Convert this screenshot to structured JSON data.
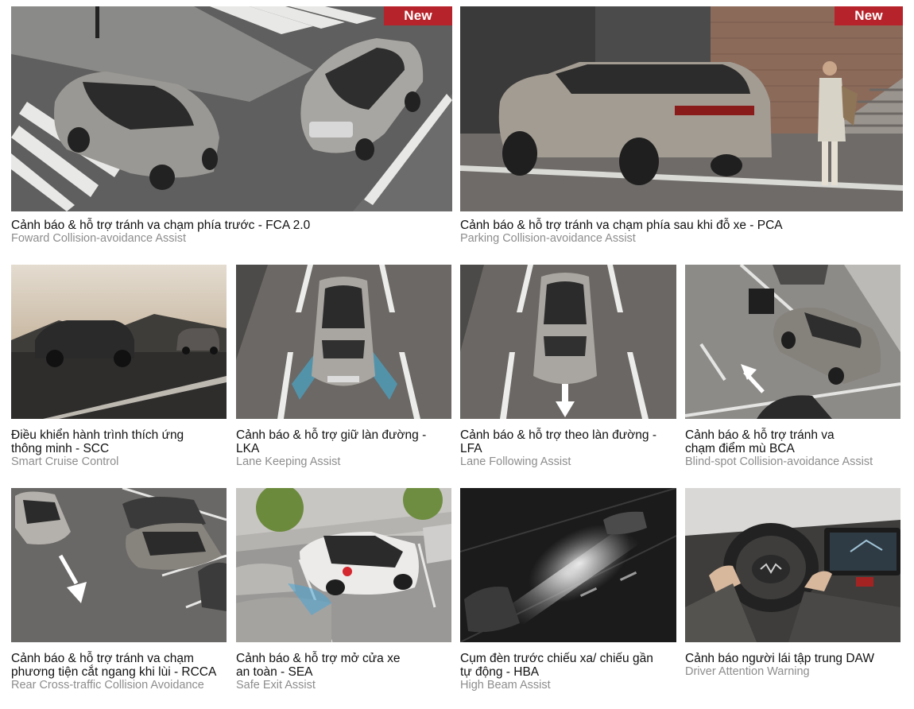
{
  "badge_label": "New",
  "colors": {
    "badge": "#b7232a",
    "title": "#111111",
    "subtitle": "#8d8d8d"
  },
  "features": [
    {
      "title": "Cảnh báo & hỗ trợ tránh va chạm phía trước - FCA 2.0",
      "subtitle": "Foward Collision-avoidance Assist",
      "is_new": true
    },
    {
      "title": "Cảnh báo & hỗ trợ tránh va chạm phía sau khi đỗ xe - PCA",
      "subtitle": "Parking Collision-avoidance Assist",
      "is_new": true
    },
    {
      "title": "Điều khiển hành trình thích ứng\nthông minh - SCC",
      "subtitle": "Smart Cruise Control",
      "is_new": false
    },
    {
      "title": "Cảnh báo & hỗ trợ giữ làn đường - LKA",
      "subtitle": "Lane Keeping Assist",
      "is_new": false
    },
    {
      "title": "Cảnh báo & hỗ trợ theo làn đường - LFA",
      "subtitle": "Lane Following Assist",
      "is_new": false
    },
    {
      "title": "Cảnh báo & hỗ trợ tránh va\nchạm điểm mù BCA",
      "subtitle": "Blind-spot Collision-avoidance Assist",
      "is_new": false
    },
    {
      "title": "Cảnh báo & hỗ trợ tránh va chạm\nphương tiện cắt ngang khi lùi - RCCA",
      "subtitle": "Rear Cross-traffic Collision Avoidance",
      "is_new": false
    },
    {
      "title": "Cảnh báo & hỗ trợ mở cửa xe\nan toàn - SEA",
      "subtitle": "Safe Exit Assist",
      "is_new": false
    },
    {
      "title": "Cụm đèn trước chiếu xa/ chiếu gần\ntự động - HBA",
      "subtitle": "High Beam Assist",
      "is_new": false
    },
    {
      "title": "Cảnh báo người lái tập trung DAW",
      "subtitle": "Driver Attention Warning",
      "is_new": false
    }
  ]
}
